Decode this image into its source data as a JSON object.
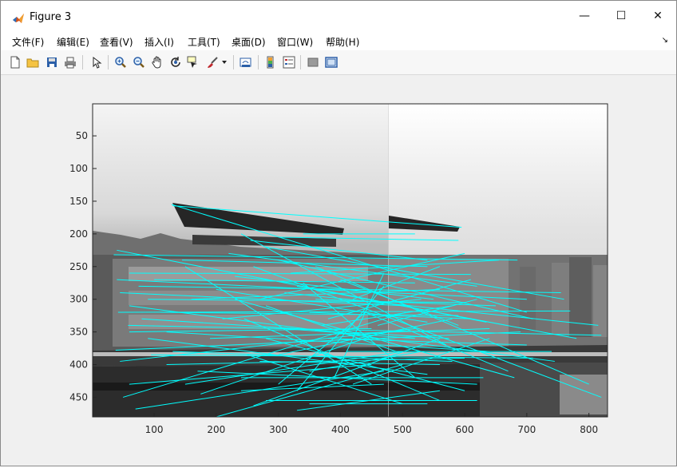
{
  "window": {
    "title": "Figure 3",
    "minimize_label": "—",
    "maximize_label": "☐",
    "close_label": "✕"
  },
  "menubar": {
    "items": [
      {
        "label": "文件(F)"
      },
      {
        "label": "编辑(E)"
      },
      {
        "label": "查看(V)"
      },
      {
        "label": "插入(I)"
      },
      {
        "label": "工具(T)"
      },
      {
        "label": "桌面(D)"
      },
      {
        "label": "窗口(W)"
      },
      {
        "label": "帮助(H)"
      }
    ],
    "overflow_label": "↘"
  },
  "toolbar": {
    "icons": [
      "new-figure-icon",
      "open-file-icon",
      "save-icon",
      "print-icon",
      "edit-plot-icon",
      "zoom-in-icon",
      "zoom-out-icon",
      "pan-icon",
      "rotate-3d-icon",
      "data-cursor-icon",
      "brush-icon",
      "link-plot-icon",
      "insert-colorbar-icon",
      "insert-legend-icon",
      "hide-plot-tools-icon",
      "show-plot-tools-icon"
    ]
  },
  "colors": {
    "match_line": "#00ffff",
    "axes_tick": "#262626"
  },
  "chart_data": {
    "type": "image-with-overlay",
    "description_of_plot": "",
    "xlim": [
      1,
      830
    ],
    "ylim": [
      1,
      480
    ],
    "y_reversed": true,
    "x_ticks": [
      "100",
      "200",
      "300",
      "400",
      "500",
      "600",
      "700",
      "800"
    ],
    "x_tick_values": [
      100,
      200,
      300,
      400,
      500,
      600,
      700,
      800
    ],
    "y_ticks": [
      "50",
      "100",
      "150",
      "200",
      "250",
      "300",
      "350",
      "400",
      "450"
    ],
    "y_tick_values": [
      50,
      100,
      150,
      200,
      250,
      300,
      350,
      400,
      450
    ],
    "image_split_x": 480,
    "match_lines": [
      [
        128,
        155,
        700,
        320
      ],
      [
        130,
        157,
        595,
        190
      ],
      [
        40,
        225,
        635,
        335
      ],
      [
        35,
        232,
        685,
        240
      ],
      [
        145,
        240,
        540,
        250
      ],
      [
        60,
        260,
        610,
        262
      ],
      [
        40,
        270,
        700,
        300
      ],
      [
        75,
        280,
        755,
        290
      ],
      [
        90,
        300,
        600,
        305
      ],
      [
        60,
        310,
        745,
        395
      ],
      [
        42,
        320,
        770,
        318
      ],
      [
        80,
        330,
        575,
        360
      ],
      [
        58,
        340,
        820,
        355
      ],
      [
        38,
        378,
        690,
        350
      ],
      [
        150,
        250,
        450,
        430
      ],
      [
        50,
        450,
        505,
        320
      ],
      [
        70,
        468,
        470,
        410
      ],
      [
        260,
        463,
        560,
        360
      ],
      [
        350,
        460,
        540,
        460
      ],
      [
        60,
        430,
        450,
        400
      ],
      [
        95,
        385,
        710,
        390
      ],
      [
        120,
        350,
        640,
        380
      ],
      [
        45,
        395,
        520,
        345
      ],
      [
        230,
        300,
        680,
        420
      ],
      [
        245,
        330,
        560,
        455
      ],
      [
        280,
        360,
        600,
        440
      ],
      [
        300,
        385,
        580,
        330
      ],
      [
        330,
        440,
        470,
        280
      ],
      [
        200,
        480,
        500,
        400
      ],
      [
        170,
        410,
        620,
        430
      ],
      [
        260,
        250,
        820,
        450
      ],
      [
        310,
        290,
        815,
        340
      ],
      [
        220,
        230,
        620,
        280
      ],
      [
        330,
        280,
        780,
        360
      ],
      [
        360,
        300,
        650,
        310
      ],
      [
        380,
        330,
        610,
        270
      ],
      [
        240,
        200,
        570,
        370
      ],
      [
        255,
        210,
        540,
        240
      ],
      [
        280,
        220,
        760,
        300
      ],
      [
        300,
        240,
        710,
        330
      ],
      [
        320,
        260,
        655,
        240
      ],
      [
        340,
        275,
        520,
        420
      ],
      [
        360,
        250,
        800,
        430
      ],
      [
        400,
        270,
        590,
        340
      ],
      [
        420,
        300,
        560,
        250
      ],
      [
        440,
        320,
        670,
        410
      ],
      [
        460,
        340,
        620,
        300
      ],
      [
        210,
        330,
        530,
        300
      ],
      [
        190,
        360,
        640,
        345
      ],
      [
        160,
        300,
        560,
        285
      ],
      [
        110,
        320,
        590,
        325
      ],
      [
        100,
        270,
        520,
        275
      ],
      [
        270,
        395,
        560,
        400
      ],
      [
        240,
        420,
        630,
        420
      ],
      [
        150,
        430,
        500,
        380
      ],
      [
        175,
        445,
        470,
        350
      ],
      [
        300,
        430,
        440,
        320
      ],
      [
        350,
        410,
        530,
        380
      ],
      [
        390,
        420,
        470,
        260
      ],
      [
        420,
        430,
        640,
        360
      ],
      [
        280,
        310,
        490,
        380
      ],
      [
        310,
        345,
        520,
        360
      ],
      [
        130,
        380,
        580,
        395
      ],
      [
        340,
        200,
        520,
        200
      ],
      [
        300,
        205,
        590,
        210
      ],
      [
        270,
        300,
        600,
        230
      ],
      [
        230,
        265,
        550,
        300
      ],
      [
        200,
        285,
        540,
        335
      ],
      [
        380,
        360,
        700,
        370
      ],
      [
        410,
        380,
        740,
        380
      ],
      [
        60,
        350,
        450,
        345
      ],
      [
        90,
        360,
        540,
        415
      ],
      [
        120,
        400,
        600,
        390
      ],
      [
        45,
        290,
        505,
        310
      ],
      [
        250,
        385,
        500,
        460
      ],
      [
        280,
        455,
        620,
        455
      ],
      [
        330,
        470,
        560,
        440
      ],
      [
        240,
        440,
        470,
        430
      ],
      [
        350,
        320,
        610,
        330
      ],
      [
        370,
        340,
        580,
        310
      ]
    ]
  }
}
